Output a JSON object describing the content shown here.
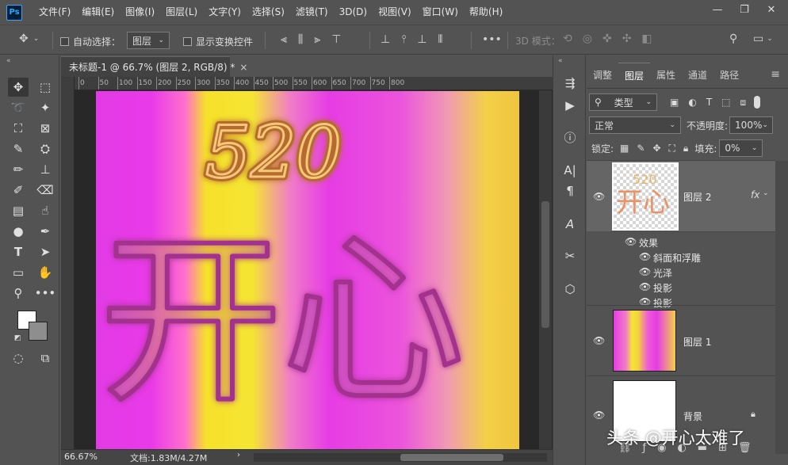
{
  "app": {
    "logo_text": "Ps"
  },
  "menubar": {
    "items": [
      "文件(F)",
      "编辑(E)",
      "图像(I)",
      "图层(L)",
      "文字(Y)",
      "选择(S)",
      "滤镜(T)",
      "3D(D)",
      "视图(V)",
      "窗口(W)",
      "帮助(H)"
    ],
    "window_controls": [
      "minimize-icon",
      "restore-icon",
      "close-icon"
    ]
  },
  "options": {
    "auto_select_label": "自动选择：",
    "auto_select_value": "图层",
    "transform_controls_label": "显示变换控件",
    "more_label": "•••",
    "mode_3d_label": "3D 模式："
  },
  "document": {
    "tab_title": "未标题-1 @ 66.7% (图层 2, RGB/8) *",
    "ruler_labels": [
      "0",
      "50",
      "100",
      "150",
      "200",
      "250",
      "300",
      "350",
      "400",
      "450",
      "500",
      "550",
      "600",
      "650",
      "700",
      "750",
      "800"
    ],
    "canvas_text_top": "520",
    "canvas_text_main": "开心"
  },
  "status": {
    "zoom": "66.67%",
    "doc_info": "文档:1.83M/4.27M"
  },
  "panel": {
    "tabs": [
      "调整",
      "图层",
      "属性",
      "通道",
      "路径"
    ],
    "active_tab": "图层",
    "filter_label": "类型",
    "blend_mode": "正常",
    "opacity_label": "不透明度:",
    "opacity_value": "100%",
    "lock_label": "锁定:",
    "fill_label": "填充:",
    "fill_value": "0%",
    "layers": [
      {
        "name": "图层 2",
        "fx": "fx",
        "selected": true
      },
      {
        "name": "图层 1",
        "selected": false
      },
      {
        "name": "背景",
        "selected": false
      }
    ],
    "effects_label": "效果",
    "effects": [
      "斜面和浮雕",
      "光泽",
      "投影",
      "投影"
    ],
    "thumb_text_top": "520",
    "thumb_text_main": "开心"
  },
  "watermark": "头条 @开心太难了",
  "colors": {
    "magenta": "#e639e6",
    "yellow": "#f2e21a",
    "panel_bg": "#535353",
    "selected_layer": "#656565"
  }
}
